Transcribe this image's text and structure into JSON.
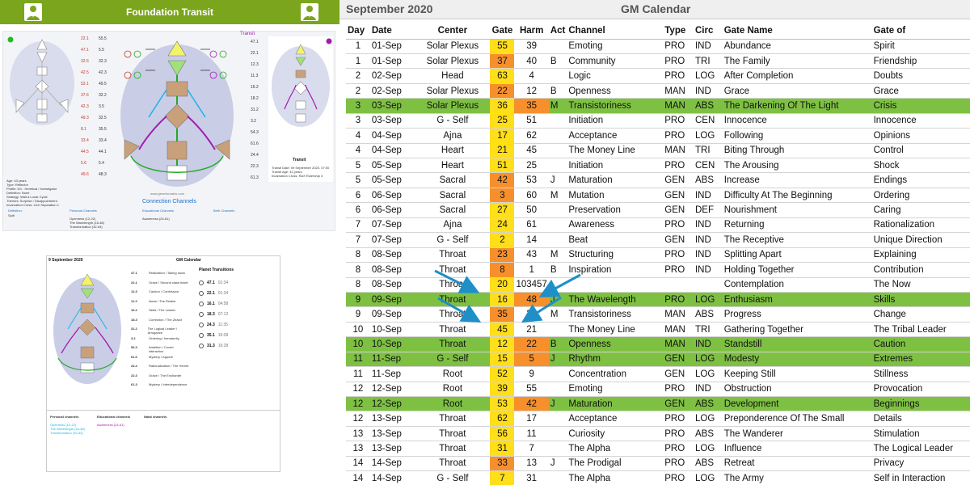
{
  "left_panel": {
    "title": "Foundation Transit",
    "connection_heading": "Connection Channels",
    "transit_label": "Transit",
    "transit_chart_title": "Transit",
    "transit_info": [
      "Transit Date: 09 September 2020, 07:00",
      "Transit Age: 43 years",
      "Incarnation Cross: RAX Rulership 3"
    ],
    "person_info": [
      "Age: 43 years",
      "Type: Reflector",
      "Profile: 5/1 : Heretical / Investigator",
      "Definition: None",
      "Strategy: Wait a Lunar Cycle",
      "Themes: Surprise / Disappointment",
      "Incarnation Cross: LAX Separation 1"
    ],
    "planets_left": [
      "22.1",
      "47.1",
      "32.6",
      "42.5",
      "53.1",
      "37.6",
      "42.3",
      "49.3",
      "8.1",
      "33.4",
      "44.5",
      "5.6",
      "49.6"
    ],
    "planets_left2": [
      "55.5",
      "5.5",
      "32.3",
      "42.3",
      "49.5",
      "32.2",
      "3.5",
      "32.5",
      "35.5",
      "33.4",
      "44.1",
      "5.4",
      "48.3"
    ],
    "planets_right": [
      "47.1",
      "22.1",
      "12.3",
      "11.3",
      "16.2",
      "18.2",
      "31.2",
      "3.2",
      "54.3",
      "61.6",
      "24.4",
      "22.3",
      "61.3"
    ],
    "columns": [
      "Definition:",
      "Personal Channels",
      "Educational Channels",
      "Birth Channels"
    ],
    "definition_value": "Split",
    "personal_channels": [
      "Openness (12-22)",
      "The Wavelength (16-48)",
      "Transformation (32-54)"
    ],
    "educational_channels": [
      "Awareness (24-61)"
    ],
    "website": "www.geneticmatrix.com"
  },
  "mini_calendar": {
    "date": "9 September 2020",
    "title": "GM Calendar",
    "planet_transitions_title": "Planet Transitions",
    "transitions": [
      {
        "gate": "47.1",
        "time": "01:34"
      },
      {
        "gate": "22.1",
        "time": "01:34"
      },
      {
        "gate": "16.1",
        "time": "04:58"
      },
      {
        "gate": "18.3",
        "time": "07:12"
      },
      {
        "gate": "24.3",
        "time": "11:35"
      },
      {
        "gate": "35.1",
        "time": "16:08"
      },
      {
        "gate": "31.3",
        "time": "16:28"
      }
    ],
    "gates": [
      {
        "gate": "47.1",
        "desc": "Realization / Taking stock"
      },
      {
        "gate": "22.1",
        "desc": "Grace / Second class ticket"
      },
      {
        "gate": "12.3",
        "desc": "Caution / Confession"
      },
      {
        "gate": "11.3",
        "desc": "Ideas / The Realist"
      },
      {
        "gate": "16.2",
        "desc": "Skills / The Leader"
      },
      {
        "gate": "18.3",
        "desc": "Correction / The Zealot"
      },
      {
        "gate": "31.2",
        "desc": "The Logical Leader / Arrogance"
      },
      {
        "gate": "3.2",
        "desc": "Ordering / Immaturity"
      },
      {
        "gate": "54.3",
        "desc": "Ambition / Covert interaction"
      },
      {
        "gate": "61.6",
        "desc": "Mystery / Appeal"
      },
      {
        "gate": "24.4",
        "desc": "Rationalization / The Hermit"
      },
      {
        "gate": "22.3",
        "desc": "Grace / The Enchanter"
      },
      {
        "gate": "61.3",
        "desc": "Mystery / Interdependence"
      }
    ],
    "bottom_headers": [
      "Personal channels",
      "Educational channels",
      "Natal channels"
    ],
    "personal": [
      "Openness (12-22)",
      "The Wavelength (16-48)",
      "Transformation (32-54)"
    ],
    "educational": [
      "Awareness (24-61)"
    ]
  },
  "calendar": {
    "month": "September 2020",
    "title": "GM Calendar",
    "columns": [
      "Day",
      "Date",
      "Center",
      "Gate",
      "Harm",
      "Act",
      "Channel",
      "Type",
      "Circ",
      "Gate Name",
      "Gate of"
    ],
    "rows": [
      {
        "day": "1",
        "date": "01-Sep",
        "center": "Solar Plexus",
        "gate": "55",
        "harm": "39",
        "act": "",
        "channel": "Emoting",
        "type": "PRO",
        "circ": "IND",
        "gate_name": "Abundance",
        "gate_of": "Spirit",
        "gate_color": "y",
        "harm_color": "",
        "hl": false
      },
      {
        "day": "1",
        "date": "01-Sep",
        "center": "Solar Plexus",
        "gate": "37",
        "harm": "40",
        "act": "B",
        "channel": "Community",
        "type": "PRO",
        "circ": "TRI",
        "gate_name": "The Family",
        "gate_of": "Friendship",
        "gate_color": "o",
        "harm_color": "",
        "hl": false
      },
      {
        "day": "2",
        "date": "02-Sep",
        "center": "Head",
        "gate": "63",
        "harm": "4",
        "act": "",
        "channel": "Logic",
        "type": "PRO",
        "circ": "LOG",
        "gate_name": "After Completion",
        "gate_of": "Doubts",
        "gate_color": "y",
        "harm_color": "",
        "hl": false
      },
      {
        "day": "2",
        "date": "02-Sep",
        "center": "Solar Plexus",
        "gate": "22",
        "harm": "12",
        "act": "B",
        "channel": "Openness",
        "type": "MAN",
        "circ": "IND",
        "gate_name": "Grace",
        "gate_of": "Grace",
        "gate_color": "o",
        "harm_color": "",
        "hl": false
      },
      {
        "day": "3",
        "date": "03-Sep",
        "center": "Solar Plexus",
        "gate": "36",
        "harm": "35",
        "act": "M",
        "channel": "Transistoriness",
        "type": "MAN",
        "circ": "ABS",
        "gate_name": "The Darkening Of The Light",
        "gate_of": "Crisis",
        "gate_color": "y",
        "harm_color": "o",
        "hl": true
      },
      {
        "day": "3",
        "date": "03-Sep",
        "center": "G - Self",
        "gate": "25",
        "harm": "51",
        "act": "",
        "channel": "Initiation",
        "type": "PRO",
        "circ": "CEN",
        "gate_name": "Innocence",
        "gate_of": "Innocence",
        "gate_color": "y",
        "harm_color": "",
        "hl": false
      },
      {
        "day": "4",
        "date": "04-Sep",
        "center": "Ajna",
        "gate": "17",
        "harm": "62",
        "act": "",
        "channel": "Acceptance",
        "type": "PRO",
        "circ": "LOG",
        "gate_name": "Following",
        "gate_of": "Opinions",
        "gate_color": "y",
        "harm_color": "",
        "hl": false
      },
      {
        "day": "4",
        "date": "04-Sep",
        "center": "Heart",
        "gate": "21",
        "harm": "45",
        "act": "",
        "channel": "The Money Line",
        "type": "MAN",
        "circ": "TRI",
        "gate_name": "Biting Through",
        "gate_of": "Control",
        "gate_color": "y",
        "harm_color": "",
        "hl": false
      },
      {
        "day": "5",
        "date": "05-Sep",
        "center": "Heart",
        "gate": "51",
        "harm": "25",
        "act": "",
        "channel": "Initiation",
        "type": "PRO",
        "circ": "CEN",
        "gate_name": "The Arousing",
        "gate_of": "Shock",
        "gate_color": "y",
        "harm_color": "",
        "hl": false
      },
      {
        "day": "5",
        "date": "05-Sep",
        "center": "Sacral",
        "gate": "42",
        "harm": "53",
        "act": "J",
        "channel": "Maturation",
        "type": "GEN",
        "circ": "ABS",
        "gate_name": "Increase",
        "gate_of": "Endings",
        "gate_color": "o",
        "harm_color": "",
        "hl": false
      },
      {
        "day": "6",
        "date": "06-Sep",
        "center": "Sacral",
        "gate": "3",
        "harm": "60",
        "act": "M",
        "channel": "Mutation",
        "type": "GEN",
        "circ": "IND",
        "gate_name": "Difficulty At The Beginning",
        "gate_of": "Ordering",
        "gate_color": "o",
        "harm_color": "",
        "hl": false
      },
      {
        "day": "6",
        "date": "06-Sep",
        "center": "Sacral",
        "gate": "27",
        "harm": "50",
        "act": "",
        "channel": "Preservation",
        "type": "GEN",
        "circ": "DEF",
        "gate_name": "Nourishment",
        "gate_of": "Caring",
        "gate_color": "y",
        "harm_color": "",
        "hl": false
      },
      {
        "day": "7",
        "date": "07-Sep",
        "center": "Ajna",
        "gate": "24",
        "harm": "61",
        "act": "",
        "channel": "Awareness",
        "type": "PRO",
        "circ": "IND",
        "gate_name": "Returning",
        "gate_of": "Rationalization",
        "gate_color": "y",
        "harm_color": "",
        "hl": false
      },
      {
        "day": "7",
        "date": "07-Sep",
        "center": "G - Self",
        "gate": "2",
        "harm": "14",
        "act": "",
        "channel": "Beat",
        "type": "GEN",
        "circ": "IND",
        "gate_name": "The Receptive",
        "gate_of": "Unique Direction",
        "gate_color": "y",
        "harm_color": "",
        "hl": false
      },
      {
        "day": "8",
        "date": "08-Sep",
        "center": "Throat",
        "gate": "23",
        "harm": "43",
        "act": "M",
        "channel": "Structuring",
        "type": "PRO",
        "circ": "IND",
        "gate_name": "Splitting Apart",
        "gate_of": "Explaining",
        "gate_color": "o",
        "harm_color": "",
        "hl": false
      },
      {
        "day": "8",
        "date": "08-Sep",
        "center": "Throat",
        "gate": "8",
        "harm": "1",
        "act": "B",
        "channel": "Inspiration",
        "type": "PRO",
        "circ": "IND",
        "gate_name": "Holding Together",
        "gate_of": "Contribution",
        "gate_color": "o",
        "harm_color": "",
        "hl": false
      },
      {
        "day": "8",
        "date": "08-Sep",
        "center": "Throat",
        "gate": "20",
        "harm": "103457",
        "act": "",
        "channel": "",
        "type": "",
        "circ": "",
        "gate_name": "Contemplation",
        "gate_of": "The Now",
        "gate_color": "y",
        "harm_color": "",
        "hl": false
      },
      {
        "day": "9",
        "date": "09-Sep",
        "center": "Throat",
        "gate": "16",
        "harm": "48",
        "act": "J",
        "channel": "The Wavelength",
        "type": "PRO",
        "circ": "LOG",
        "gate_name": "Enthusiasm",
        "gate_of": "Skills",
        "gate_color": "y",
        "harm_color": "o",
        "hl": true
      },
      {
        "day": "9",
        "date": "09-Sep",
        "center": "Throat",
        "gate": "35",
        "harm": "36",
        "act": "M",
        "channel": "Transistoriness",
        "type": "MAN",
        "circ": "ABS",
        "gate_name": "Progress",
        "gate_of": "Change",
        "gate_color": "o",
        "harm_color": "",
        "hl": false
      },
      {
        "day": "10",
        "date": "10-Sep",
        "center": "Throat",
        "gate": "45",
        "harm": "21",
        "act": "",
        "channel": "The Money Line",
        "type": "MAN",
        "circ": "TRI",
        "gate_name": "Gathering Together",
        "gate_of": "The Tribal Leader",
        "gate_color": "y",
        "harm_color": "",
        "hl": false
      },
      {
        "day": "10",
        "date": "10-Sep",
        "center": "Throat",
        "gate": "12",
        "harm": "22",
        "act": "B",
        "channel": "Openness",
        "type": "MAN",
        "circ": "IND",
        "gate_name": "Standstill",
        "gate_of": "Caution",
        "gate_color": "y",
        "harm_color": "o",
        "hl": true
      },
      {
        "day": "11",
        "date": "11-Sep",
        "center": "G - Self",
        "gate": "15",
        "harm": "5",
        "act": "J",
        "channel": "Rhythm",
        "type": "GEN",
        "circ": "LOG",
        "gate_name": "Modesty",
        "gate_of": "Extremes",
        "gate_color": "y",
        "harm_color": "o",
        "hl": true
      },
      {
        "day": "11",
        "date": "11-Sep",
        "center": "Root",
        "gate": "52",
        "harm": "9",
        "act": "",
        "channel": "Concentration",
        "type": "GEN",
        "circ": "LOG",
        "gate_name": "Keeping Still",
        "gate_of": "Stillness",
        "gate_color": "y",
        "harm_color": "",
        "hl": false
      },
      {
        "day": "12",
        "date": "12-Sep",
        "center": "Root",
        "gate": "39",
        "harm": "55",
        "act": "",
        "channel": "Emoting",
        "type": "PRO",
        "circ": "IND",
        "gate_name": "Obstruction",
        "gate_of": "Provocation",
        "gate_color": "y",
        "harm_color": "",
        "hl": false
      },
      {
        "day": "12",
        "date": "12-Sep",
        "center": "Root",
        "gate": "53",
        "harm": "42",
        "act": "J",
        "channel": "Maturation",
        "type": "GEN",
        "circ": "ABS",
        "gate_name": "Development",
        "gate_of": "Beginnings",
        "gate_color": "y",
        "harm_color": "o",
        "hl": true
      },
      {
        "day": "12",
        "date": "13-Sep",
        "center": "Throat",
        "gate": "62",
        "harm": "17",
        "act": "",
        "channel": "Acceptance",
        "type": "PRO",
        "circ": "LOG",
        "gate_name": "Preponderence Of The Small",
        "gate_of": "Details",
        "gate_color": "y",
        "harm_color": "",
        "hl": false
      },
      {
        "day": "13",
        "date": "13-Sep",
        "center": "Throat",
        "gate": "56",
        "harm": "11",
        "act": "",
        "channel": "Curiosity",
        "type": "PRO",
        "circ": "ABS",
        "gate_name": "The Wanderer",
        "gate_of": "Stimulation",
        "gate_color": "y",
        "harm_color": "",
        "hl": false
      },
      {
        "day": "13",
        "date": "13-Sep",
        "center": "Throat",
        "gate": "31",
        "harm": "7",
        "act": "",
        "channel": "The Alpha",
        "type": "PRO",
        "circ": "LOG",
        "gate_name": "Influence",
        "gate_of": "The Logical Leader",
        "gate_color": "y",
        "harm_color": "",
        "hl": false
      },
      {
        "day": "14",
        "date": "14-Sep",
        "center": "Throat",
        "gate": "33",
        "harm": "13",
        "act": "J",
        "channel": "The Prodigal",
        "type": "PRO",
        "circ": "ABS",
        "gate_name": "Retreat",
        "gate_of": "Privacy",
        "gate_color": "o",
        "harm_color": "",
        "hl": false
      },
      {
        "day": "14",
        "date": "14-Sep",
        "center": "G - Self",
        "gate": "7",
        "harm": "31",
        "act": "",
        "channel": "The Alpha",
        "type": "PRO",
        "circ": "LOG",
        "gate_name": "The Army",
        "gate_of": "Self in Interaction",
        "gate_color": "y",
        "harm_color": "",
        "hl": false
      }
    ]
  },
  "colors": {
    "green_bar": "#7aa51c",
    "row_highlight": "#7ec142",
    "gate_yellow": "#ffde1a",
    "gate_orange": "#f7902c",
    "arrow": "#1f8fc8",
    "channel_magenta": "#a21caf",
    "channel_cyan": "#19b5e6"
  }
}
